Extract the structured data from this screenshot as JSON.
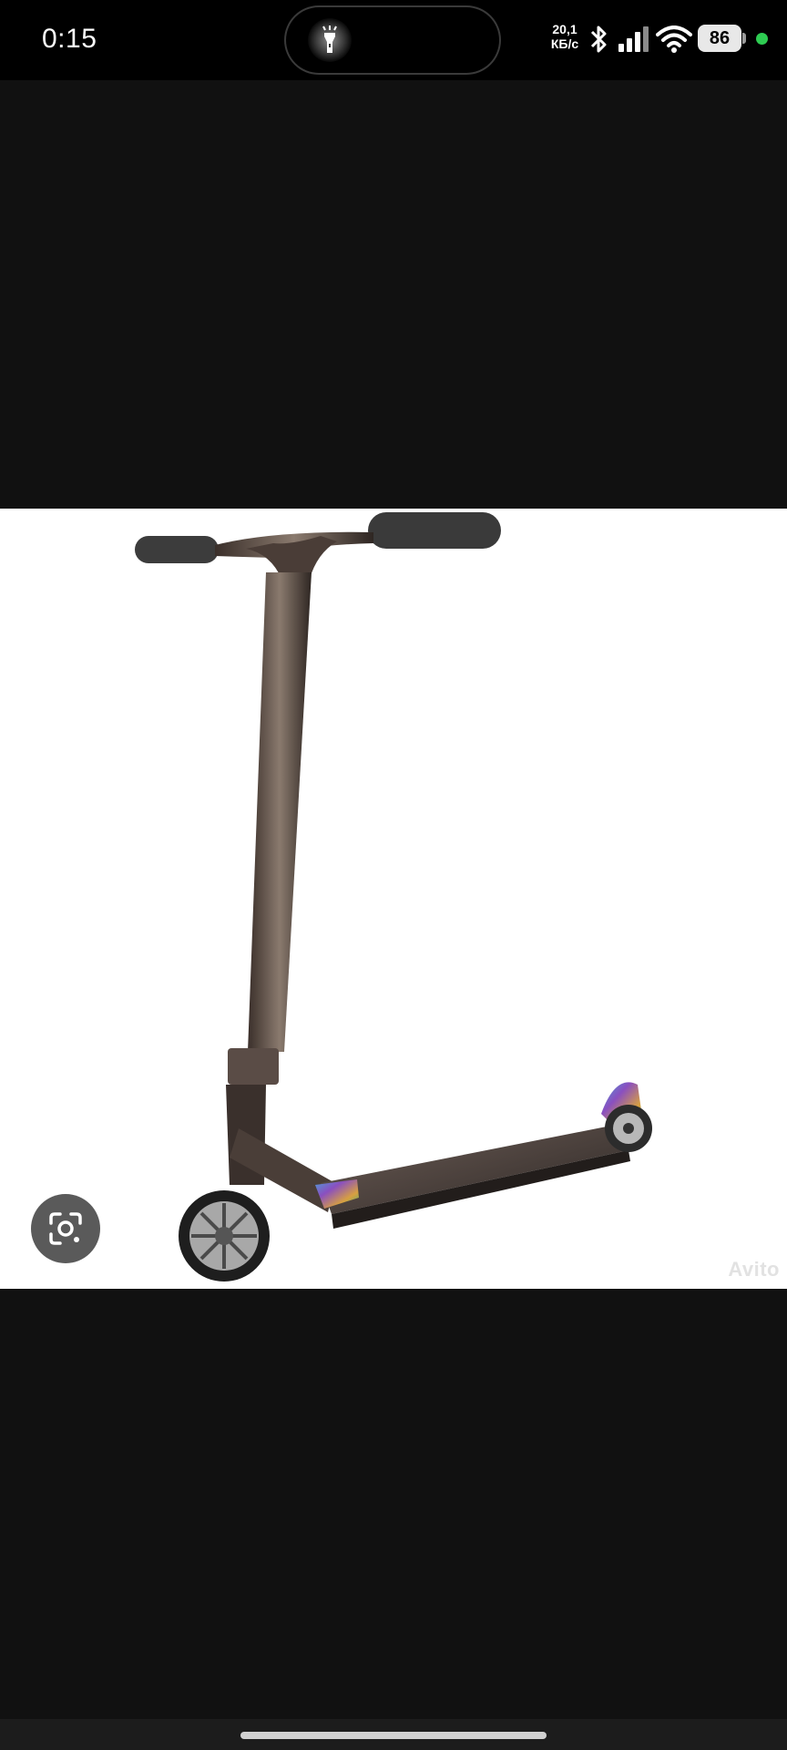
{
  "status_bar": {
    "time": "0:15",
    "net_speed_value": "20,1",
    "net_speed_unit": "КБ/с",
    "battery_level": "86",
    "icons": [
      "flashlight-icon",
      "bluetooth-icon",
      "signal-icon",
      "wifi-icon",
      "battery-icon"
    ],
    "privacy_dot_color": "#2ecc52"
  },
  "image_viewer": {
    "watermark": "Avito",
    "lens_button_icon": "google-lens-icon",
    "background_color": "#111111"
  }
}
